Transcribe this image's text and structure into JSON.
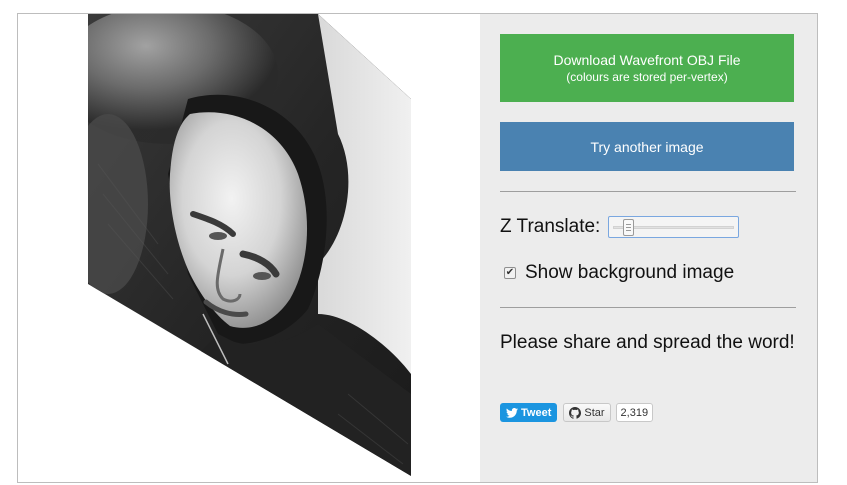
{
  "sidebar": {
    "download_button": {
      "title": "Download Wavefront OBJ File",
      "subtitle": "(colours are stored per-vertex)"
    },
    "try_button": {
      "label": "Try another image"
    },
    "z_translate": {
      "label": "Z Translate:",
      "value": 0.1
    },
    "show_background": {
      "label": "Show background image",
      "checked": true
    },
    "share_text": "Please share and spread the word!",
    "tweet_button": {
      "label": "Tweet",
      "icon": "twitter-bird-icon"
    },
    "github_star": {
      "label": "Star",
      "count": "2,319",
      "icon": "github-octocat-icon"
    }
  },
  "colors": {
    "download_button": "#4caf50",
    "try_button": "#4a82b1",
    "sidebar_bg": "#ececec",
    "tweet_bg": "#1b95e0"
  },
  "viewport": {
    "content": "grayscale 3D face render, skewed parallelogram"
  }
}
